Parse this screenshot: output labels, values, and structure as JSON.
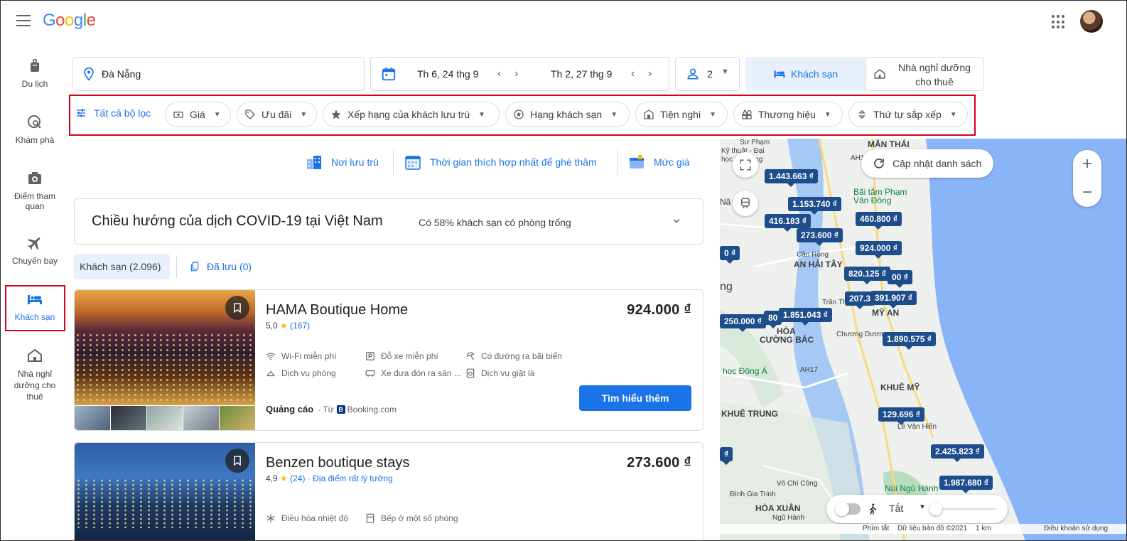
{
  "header": {
    "logo": [
      "G",
      "o",
      "o",
      "g",
      "l",
      "e"
    ],
    "logo_colors": [
      "#4285f4",
      "#ea4335",
      "#fbbc05",
      "#4285f4",
      "#34a853",
      "#ea4335"
    ]
  },
  "rail": [
    {
      "label": "Du lịch",
      "icon": "luggage-icon"
    },
    {
      "label": "Khám phá",
      "icon": "explore-icon"
    },
    {
      "label": "Điểm tham quan",
      "icon": "camera-icon"
    },
    {
      "label": "Chuyến bay",
      "icon": "flight-icon"
    },
    {
      "label": "Khách sạn",
      "icon": "hotel-icon",
      "active": true
    },
    {
      "label": "Nhà nghỉ dưỡng cho thuê",
      "icon": "vacation-rental-icon"
    }
  ],
  "search": {
    "destination": "Đà Nẵng",
    "checkin": "Th 6, 24 thg 9",
    "checkout": "Th 2, 27 thg 9",
    "guests": "2",
    "tab_hotels": "Khách sạn",
    "tab_rentals": "Nhà nghỉ dưỡng cho thuê"
  },
  "filters": {
    "all": "Tất cả bộ lọc",
    "chips": [
      "Giá",
      "Ưu đãi",
      "Xếp hạng của khách lưu trú",
      "Hạng khách sạn",
      "Tiện nghi",
      "Thương hiệu",
      "Thứ tự sắp xếp"
    ]
  },
  "insights": [
    "Nơi lưu trú",
    "Thời gian thích hợp nhất để ghé thăm",
    "Mức giá"
  ],
  "covid": {
    "title": "Chiều hướng của dịch COVID-19 tại Việt Nam",
    "subtitle": "Có 58% khách sạn có phòng trống"
  },
  "tabs": {
    "hotels": "Khách sạn (2.096)",
    "saved": "Đã lưu (0)"
  },
  "results": [
    {
      "name": "HAMA Boutique Home",
      "price": "924.000 ₫",
      "rating": "5,0",
      "reviews": "(167)",
      "amenities": [
        "Wi-Fi miễn phí",
        "Đỗ xe miễn phí",
        "Có đường ra bãi biển",
        "Dịch vụ phòng",
        "Xe đưa đón ra sân ...",
        "Dịch vụ giặt là"
      ],
      "ad_label": "Quảng cáo",
      "ad_from": "· Từ",
      "ad_source": "Booking.com",
      "cta": "Tìm hiểu thêm"
    },
    {
      "name": "Benzen boutique stays",
      "price": "273.600 ₫",
      "rating": "4,9",
      "reviews": "(24)",
      "location_note": "· Địa điểm rất lý tưởng",
      "amenities": [
        "Điều hòa nhiệt độ",
        "Bếp ở một số phòng"
      ]
    }
  ],
  "map": {
    "update_button": "Cập nhật danh sách",
    "zoom_in": "+",
    "zoom_out": "−",
    "transit_label": "Tắt",
    "price_tags": [
      "1.443.663 ₫",
      "1.153.740 ₫",
      "460.800 ₫",
      "416.183 ₫",
      "273.600 ₫",
      "924.000 ₫",
      "0 ₫",
      "820.125 ₫",
      "00 ₫",
      "207.3",
      "391.907 ₫",
      "250.000 ₫",
      "80",
      "1.851.043 ₫",
      "1.890.575 ₫",
      "129.696 ₫",
      "₫",
      "2.425.823 ₫",
      "1.987.680 ₫"
    ],
    "places": [
      "Bãi tắm Phạm",
      "Văn Đồng",
      "AN HẢI TÂY",
      "MỸ AN",
      "HÒA",
      "CƯỜNG BẮC",
      "học Đông Á",
      "KHUÊ MỸ",
      "KHUÊ TRUNG",
      "Núi Ngũ Hành",
      "HÒA XUÂN",
      "Sư Phạm",
      "Kỹ thuật - Đại",
      "học Đà Nẵng",
      "MÂN THÁI",
      "AH17",
      "AH17",
      "Cầu Rồng",
      "Trần Thị Lý",
      "ng",
      "Nă",
      "Đình Gia Trinh",
      "Võ Chí Công",
      "Lê Văn Hiến",
      "Chương Dương",
      "Ngũ Hành"
    ],
    "footer": [
      "Phím tắt",
      "Dữ liệu bản đồ ©2021",
      "1 km",
      "Điều khoản sử dụng"
    ]
  }
}
